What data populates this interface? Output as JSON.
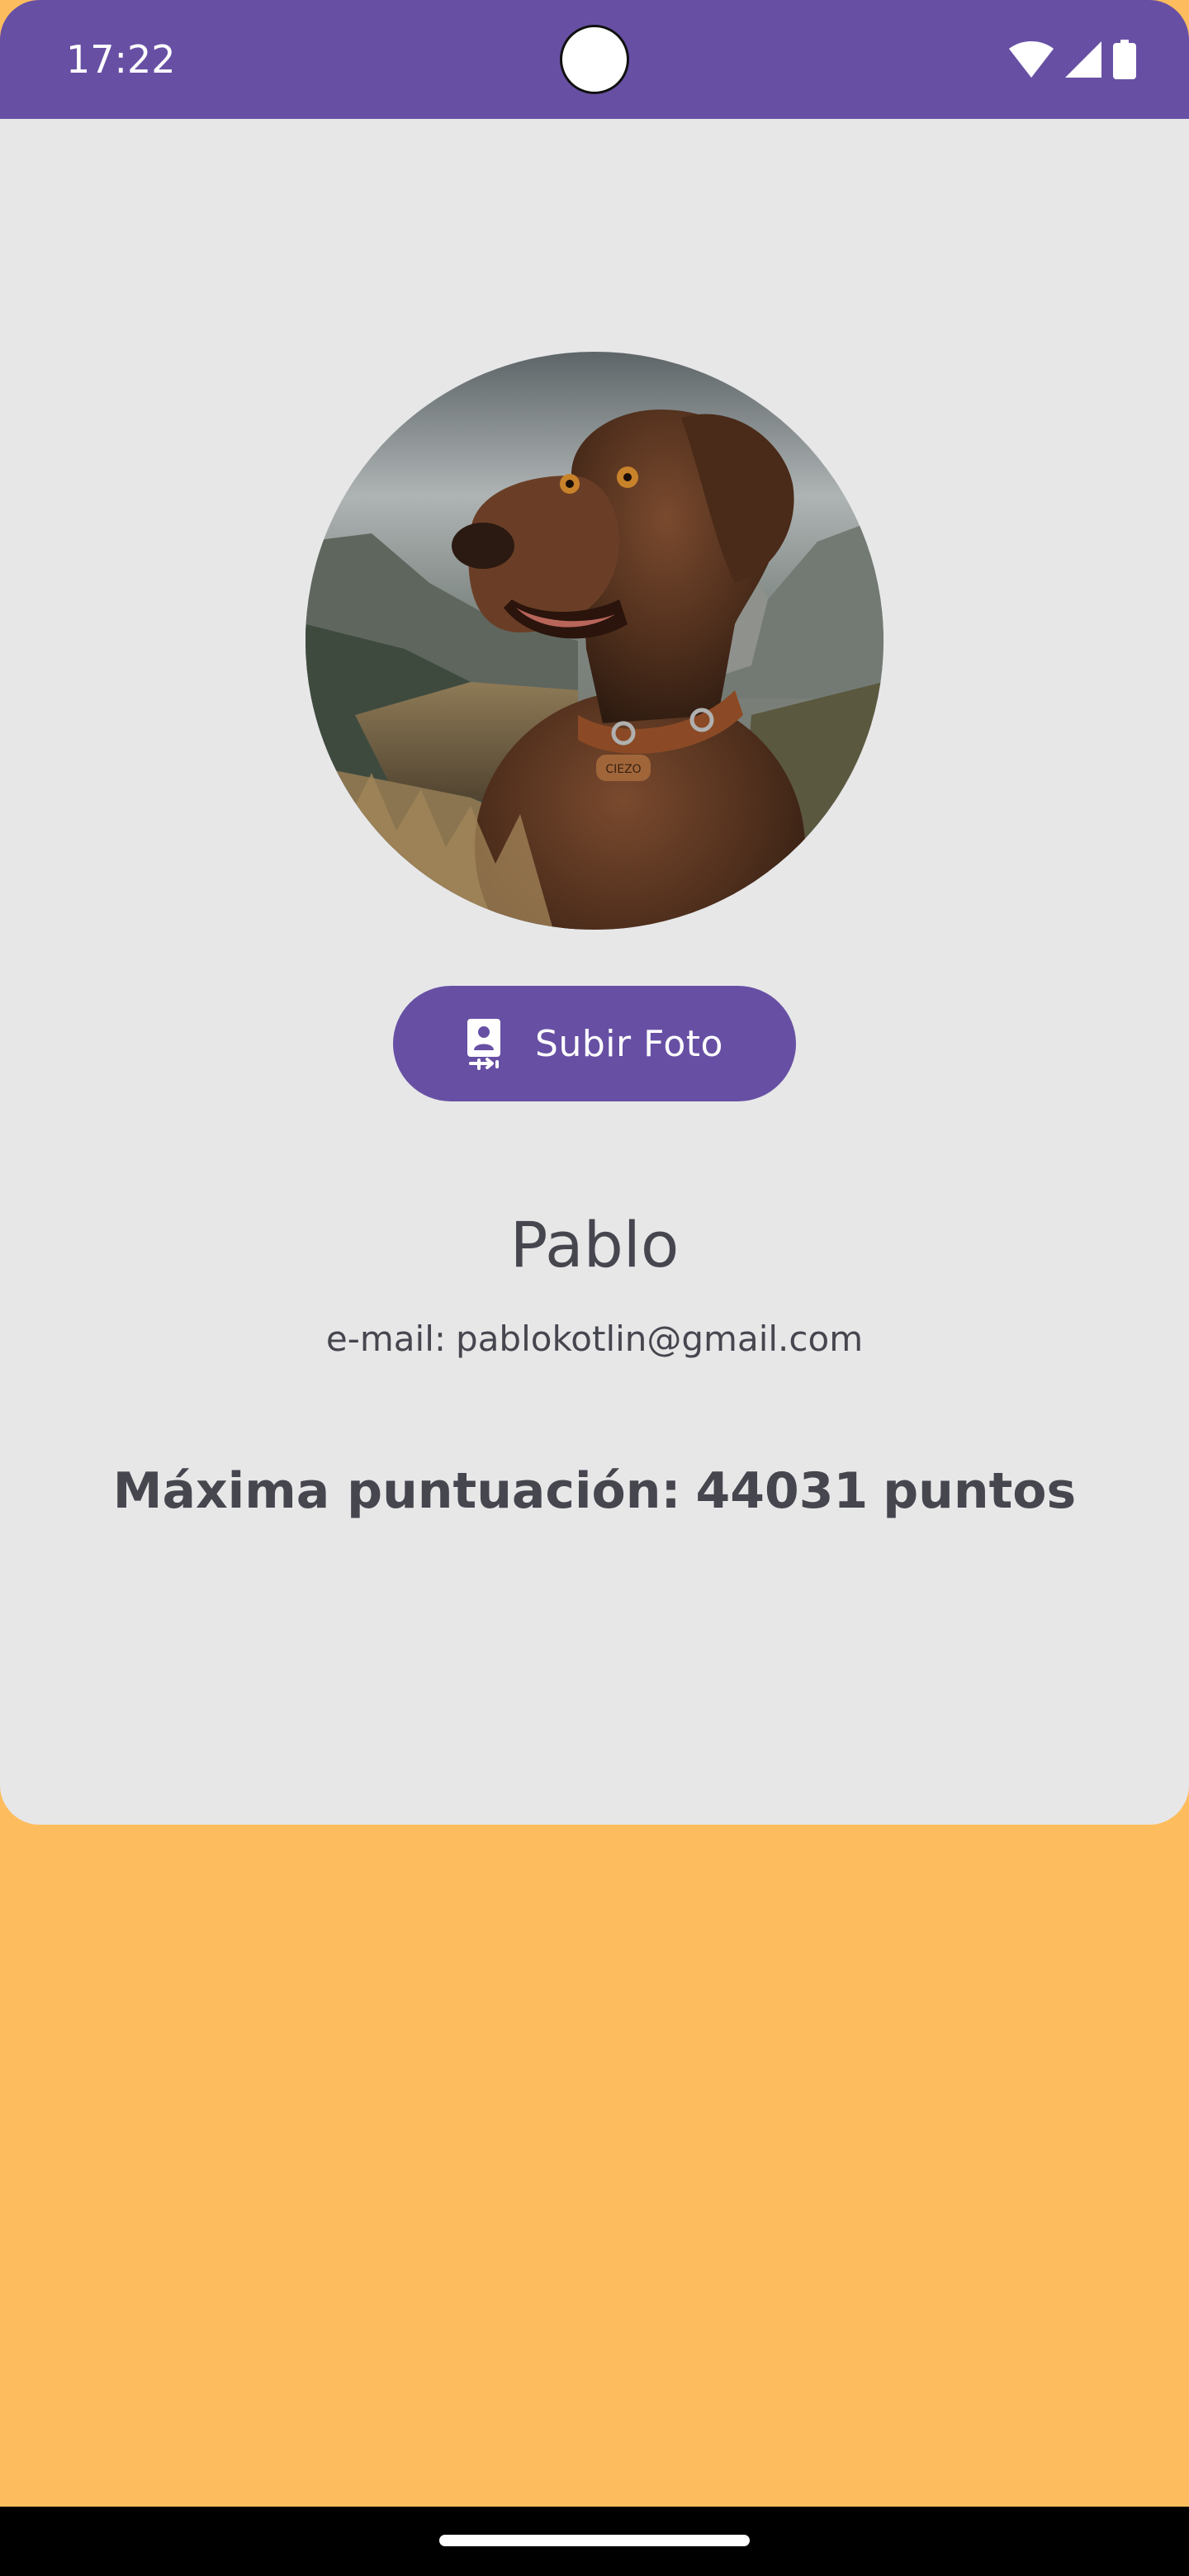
{
  "status_bar": {
    "time": "17:22",
    "icons": [
      "wifi-icon",
      "signal-icon",
      "battery-icon"
    ],
    "background_color": "#6750A4"
  },
  "profile": {
    "avatar_icon": "dog-photo",
    "upload_button": {
      "icon": "upload-photo-icon",
      "label": "Subir Foto"
    },
    "name": "Pablo",
    "email_prefix": "e-mail:",
    "email": "pablokotlin@gmail.com",
    "high_score_label": "Máxima puntuación:",
    "high_score_value": "44031",
    "high_score_unit": "puntos"
  },
  "colors": {
    "primary": "#6750A4",
    "card_background": "#E7E7E8",
    "page_background": "#FDBD5E",
    "text": "#46464F"
  }
}
